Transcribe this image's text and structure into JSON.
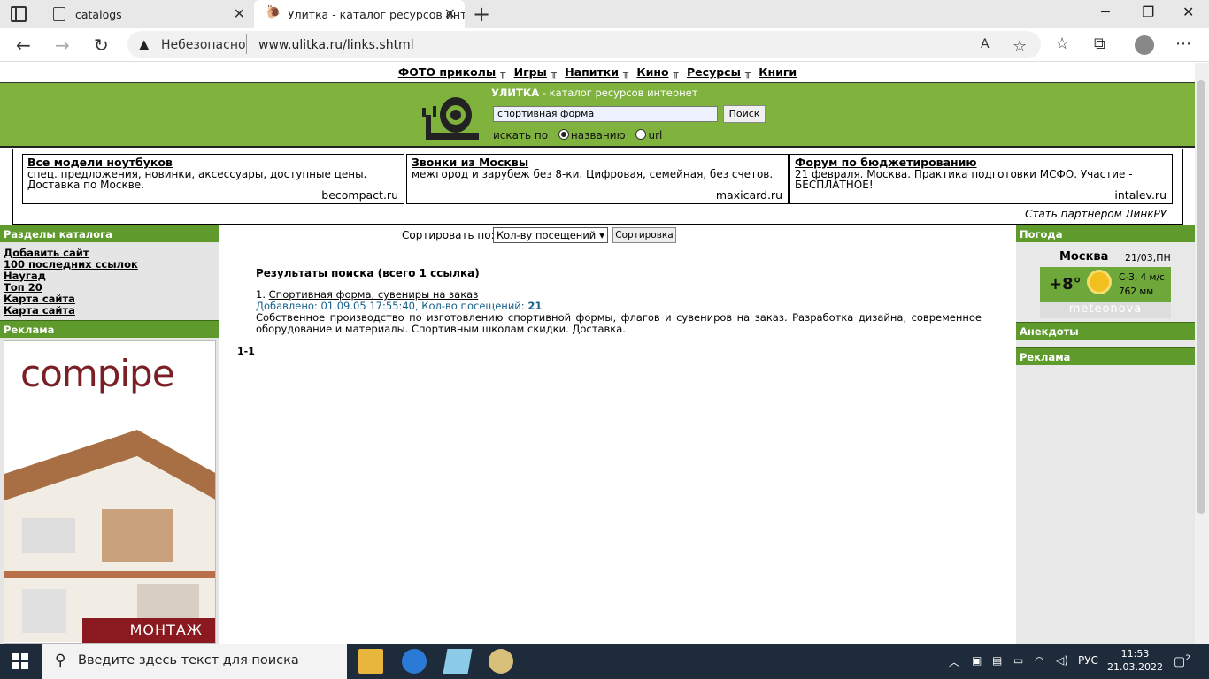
{
  "browser": {
    "tabs": [
      {
        "label": "catalogs"
      },
      {
        "label": "Улитка - каталог ресурсов инте"
      }
    ],
    "security": "Небезопасно",
    "url": "www.ulitka.ru/links.shtml"
  },
  "topmenu": [
    "ФОТО приколы",
    "Игры",
    "Напитки",
    "Кино",
    "Ресурсы",
    "Книги"
  ],
  "header": {
    "site_name": "УЛИТКА",
    "site_tagline": " - каталог ресурсов интернет",
    "search_value": "спортивная форма",
    "search_button": "Поиск",
    "search_in_label": "искать по",
    "radio_name": "названию",
    "radio_url": "url"
  },
  "ads": [
    {
      "title": "Все модели ноутбуков",
      "text": "спец. предложения, новинки, аксессуары, доступные цены. Доставка по Москве.",
      "source": "becompact.ru"
    },
    {
      "title": "Звонки из Москвы",
      "text": "межгород и зарубеж без 8-ки. Цифровая, семейная, без счетов.",
      "source": "maxicard.ru"
    },
    {
      "title": "Форум по бюджетированию",
      "text": "21 февраля. Москва. Практика подготовки МСФО. Участие - БЕСПЛАТНОЕ!",
      "source": "intalev.ru"
    }
  ],
  "partner_link": "Стать партнером ЛинкРУ",
  "left": {
    "sections_title": "Разделы каталога",
    "links": [
      "Добавить сайт",
      "100 последних ссылок",
      "Наугад",
      "Топ 20",
      "Карта сайта",
      "Карта сайта"
    ],
    "ads_title": "Реклама",
    "banner_logo": "compipe",
    "banner_caption": "МОНТАЖ"
  },
  "center": {
    "sort_label": "Сортировать по:",
    "sort_value": "Кол-ву посещений",
    "sort_button": "Сортировка",
    "results_title": "Результаты поиска (всего 1 ссылка)",
    "result": {
      "num": "1.",
      "title": "Спортивная форма, сувениры на заказ",
      "meta": "Добавлено: 01.09.05 17:55:40, Кол-во посещений:",
      "visits": "21",
      "desc": "Собственное производство по изготовлению спортивной формы, флагов и сувениров на заказ. Разработка дизайна, современное оборудование и материалы. Спортивным школам скидки. Доставка."
    },
    "pager": "1-1"
  },
  "right": {
    "weather_title": "Погода",
    "city": "Москва",
    "date": "21/03,ПН",
    "temp": "+8°",
    "wind": "С-З, 4 м/с",
    "pressure": "762 мм",
    "brand": "meteonova",
    "jokes_title": "Анекдоты",
    "ads_title": "Реклама"
  },
  "taskbar": {
    "search_placeholder": "Введите здесь текст для поиска",
    "lang": "РУС",
    "time": "11:53",
    "date": "21.03.2022",
    "notifications": "2"
  }
}
